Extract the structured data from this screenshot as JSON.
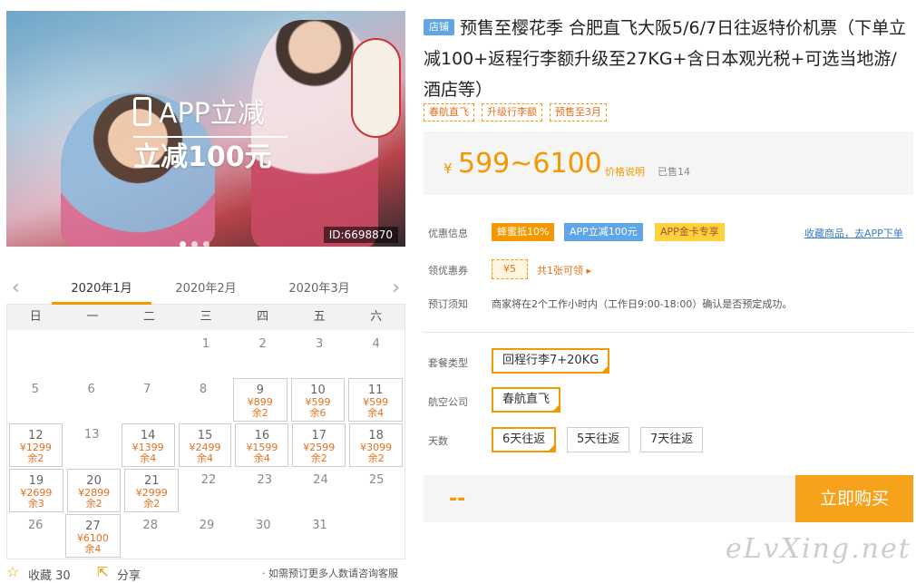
{
  "hero": {
    "app_text": "APP立减",
    "discount_text": "立减100元",
    "image_id": "ID:6698870"
  },
  "calendar": {
    "months": [
      "2020年1月",
      "2020年2月",
      "2020年3月"
    ],
    "active_month": "2020年1月",
    "weekdays": [
      "日",
      "一",
      "二",
      "三",
      "四",
      "五",
      "六"
    ],
    "weeks": [
      [
        {
          "d": ""
        },
        {
          "d": ""
        },
        {
          "d": ""
        },
        {
          "d": "1"
        },
        {
          "d": "2"
        },
        {
          "d": "3"
        },
        {
          "d": "4"
        }
      ],
      [
        {
          "d": "5"
        },
        {
          "d": "6"
        },
        {
          "d": "7"
        },
        {
          "d": "8"
        },
        {
          "d": "9",
          "p": "¥899",
          "s": "余2"
        },
        {
          "d": "10",
          "p": "¥599",
          "s": "余6"
        },
        {
          "d": "11",
          "p": "¥599",
          "s": "余4"
        }
      ],
      [
        {
          "d": "12",
          "p": "¥1299",
          "s": "余2"
        },
        {
          "d": "13"
        },
        {
          "d": "14",
          "p": "¥1399",
          "s": "余4"
        },
        {
          "d": "15",
          "p": "¥2499",
          "s": "余4"
        },
        {
          "d": "16",
          "p": "¥1599",
          "s": "余4"
        },
        {
          "d": "17",
          "p": "¥2599",
          "s": "余2"
        },
        {
          "d": "18",
          "p": "¥3099",
          "s": "余2"
        }
      ],
      [
        {
          "d": "19",
          "p": "¥2699",
          "s": "余3"
        },
        {
          "d": "20",
          "p": "¥2899",
          "s": "余2"
        },
        {
          "d": "21",
          "p": "¥2999",
          "s": "余2"
        },
        {
          "d": "22"
        },
        {
          "d": "23"
        },
        {
          "d": "24"
        },
        {
          "d": "25"
        }
      ],
      [
        {
          "d": "26"
        },
        {
          "d": "27",
          "p": "¥6100",
          "s": "余4"
        },
        {
          "d": "28"
        },
        {
          "d": "29"
        },
        {
          "d": "30"
        },
        {
          "d": "31"
        },
        {
          "d": ""
        }
      ]
    ]
  },
  "bottom": {
    "favorite_label": "收藏 30",
    "share_label": "分享",
    "note": "· 如需预订更多人数请咨询客服"
  },
  "product": {
    "shop_tag": "店铺",
    "title": "预售至樱花季 合肥直飞大阪5/6/7日往返特价机票（下单立减100+返程行李额升级至27KG+含日本观光税+可选当地游/酒店等）",
    "tags": [
      "春航直飞",
      "升级行李额",
      "预售至3月"
    ],
    "currency": "¥",
    "price_range": "599~6100",
    "price_explain": "价格说明",
    "sold": "已售14"
  },
  "offers": {
    "label": "优惠信息",
    "promos": [
      "蜂蜜抵10%",
      "APP立减100元",
      "APP金卡专享"
    ],
    "collect_link": "收藏商品，去APP下单",
    "coupon_label": "领优惠券",
    "coupon_value": "¥5",
    "coupon_info": "共1张可领 ▸",
    "notice_label": "预订须知",
    "notice": "商家将在2个工作小时内（工作日9:00-18:00）确认是否预定成功。"
  },
  "options": {
    "package_label": "套餐类型",
    "package_value": "回程行李7+20KG",
    "airline_label": "航空公司",
    "airline_value": "春航直飞",
    "days_label": "天数",
    "days": [
      "6天往返",
      "5天往返",
      "7天往返"
    ]
  },
  "buy": {
    "total": "--",
    "button": "立即购买"
  },
  "watermark": "eLvXing.net"
}
